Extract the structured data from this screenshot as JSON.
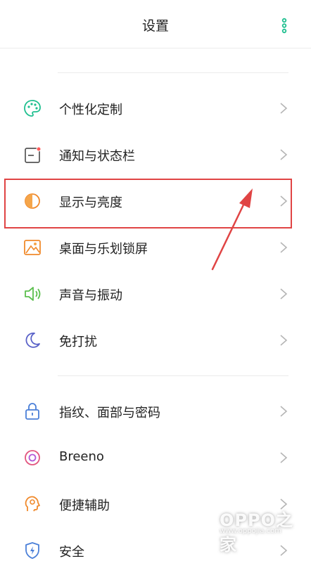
{
  "header": {
    "title": "设置",
    "more_icon": "more-vertical-icon"
  },
  "colors": {
    "accent": "#1fbf8f",
    "highlight_border": "#e04444",
    "chevron": "#b5b5b5"
  },
  "groups": [
    {
      "items": [
        {
          "label": "个性化定制",
          "icon": "palette-icon"
        },
        {
          "label": "通知与状态栏",
          "icon": "notification-icon"
        },
        {
          "label": "显示与亮度",
          "icon": "brightness-icon",
          "highlighted": true
        },
        {
          "label": "桌面与乐划锁屏",
          "icon": "wallpaper-icon"
        },
        {
          "label": "声音与振动",
          "icon": "sound-icon"
        },
        {
          "label": "免打扰",
          "icon": "moon-icon"
        }
      ]
    },
    {
      "items": [
        {
          "label": "指纹、面部与密码",
          "icon": "lock-icon"
        },
        {
          "label": "Breeno",
          "icon": "breeno-icon"
        },
        {
          "label": "便捷辅助",
          "icon": "assist-icon"
        },
        {
          "label": "安全",
          "icon": "security-icon"
        }
      ]
    }
  ],
  "watermark": {
    "brand": "OPPO之家",
    "url": "www.oppojia.com"
  }
}
